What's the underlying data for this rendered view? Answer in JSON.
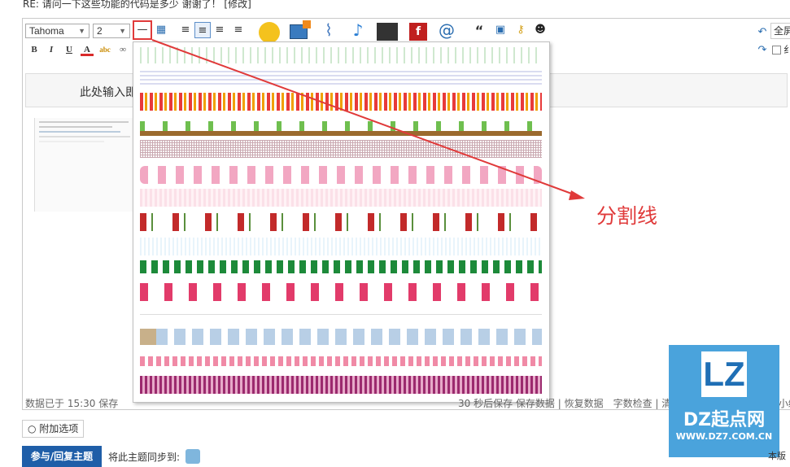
{
  "topline": "RE: 请问一下这些功能的代码是多少 谢谢了！ [修改]",
  "toolbar": {
    "font_family": "Tahoma",
    "font_size": "2",
    "fullscreen": "全屏",
    "right_label2": "纟"
  },
  "placeholder": "此处输入即",
  "status": {
    "left": "数据已于 15:30 保存",
    "right": "30 秒后保存 保存数据 | 恢复数据　字数检查 | 清除内容　加大编辑框 | 缩小编"
  },
  "attach": "附加选项",
  "submit": "参与/回复主题",
  "sync": "将此主题同步到:",
  "annotation": "分割线",
  "logo": {
    "mark": "LZ",
    "brand": "DZ起点网",
    "url": "WWW.DZ7.COM.CN"
  },
  "corner": "本版"
}
